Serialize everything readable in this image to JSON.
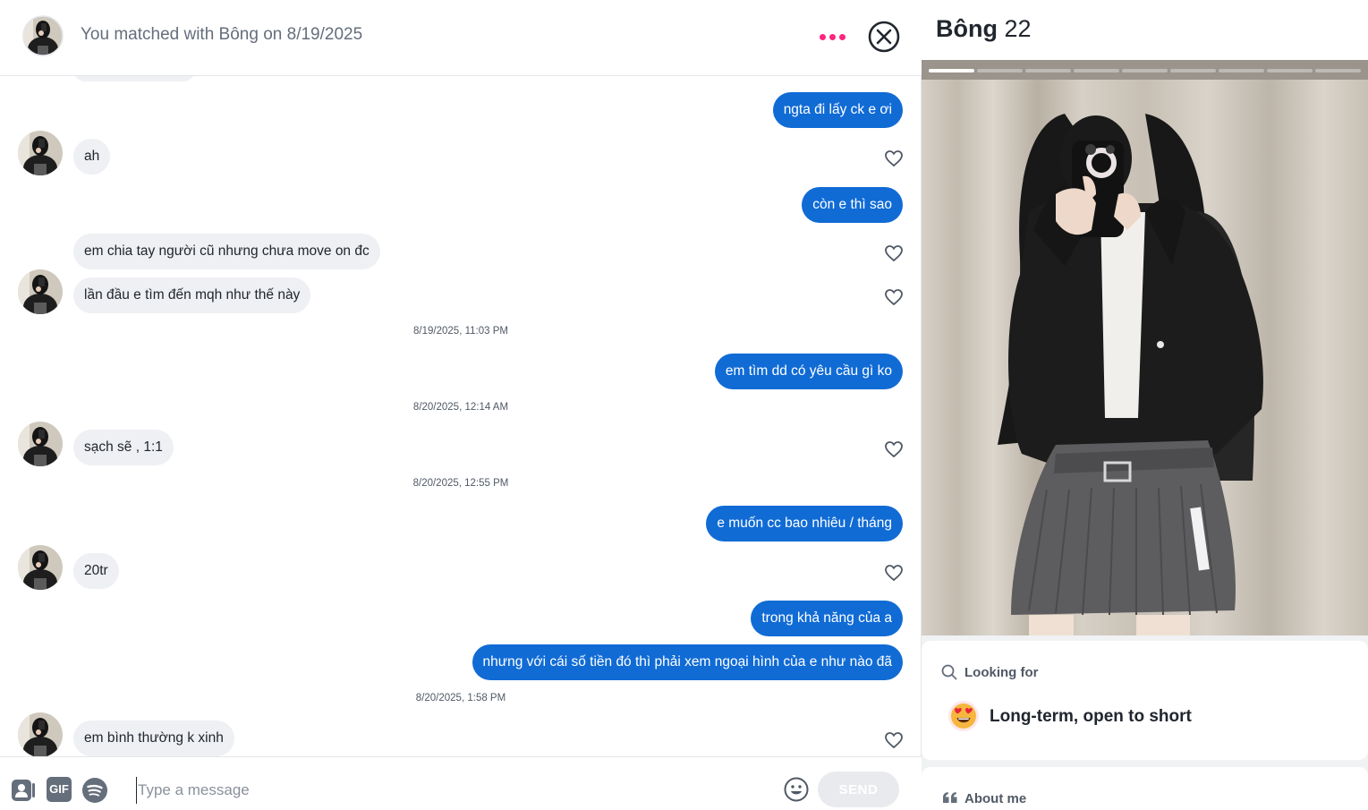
{
  "chat": {
    "header": {
      "match_text": "You matched with Bông on 8/19/2025"
    },
    "messages": [
      {
        "type": "sent",
        "text": "ngta đi lấy ck e ơi"
      },
      {
        "type": "received",
        "text": "ah"
      },
      {
        "type": "sent",
        "text": "còn e thì sao"
      },
      {
        "type": "received",
        "text": "em chia tay người cũ nhưng chưa move on đc"
      },
      {
        "type": "received",
        "text": "lần đầu e tìm đến mqh như thế này"
      },
      {
        "type": "timestamp",
        "text": "8/19/2025, 11:03 PM"
      },
      {
        "type": "sent",
        "text": "em tìm dd có yêu cầu gì ko"
      },
      {
        "type": "timestamp",
        "text": "8/20/2025, 12:14 AM"
      },
      {
        "type": "received",
        "text": "sạch sẽ , 1:1"
      },
      {
        "type": "timestamp",
        "text": "8/20/2025, 12:55 PM"
      },
      {
        "type": "sent",
        "text": "e muốn cc bao nhiêu / tháng"
      },
      {
        "type": "received",
        "text": "20tr"
      },
      {
        "type": "sent",
        "text": "trong khả năng của a"
      },
      {
        "type": "sent",
        "text": "nhưng với cái số tiền đó thì phải xem ngoại hình của e như nào đã"
      },
      {
        "type": "timestamp",
        "text": "8/20/2025, 1:58 PM"
      },
      {
        "type": "received",
        "text": "em bình thường k xinh"
      }
    ],
    "composer": {
      "gif_label": "GIF",
      "placeholder": "Type a message",
      "send_label": "SEND"
    }
  },
  "profile": {
    "name": "Bông",
    "age": "22",
    "photo_count": 9,
    "active_photo": 1,
    "looking_for": {
      "label": "Looking for",
      "emoji": "heart-eyes-emoji",
      "value": "Long-term, open to short"
    },
    "about_me": {
      "label": "About me"
    }
  },
  "colors": {
    "sent_bubble": "#106bd5",
    "received_bubble": "#eef0f3",
    "brand_dots": "#fd267d"
  }
}
